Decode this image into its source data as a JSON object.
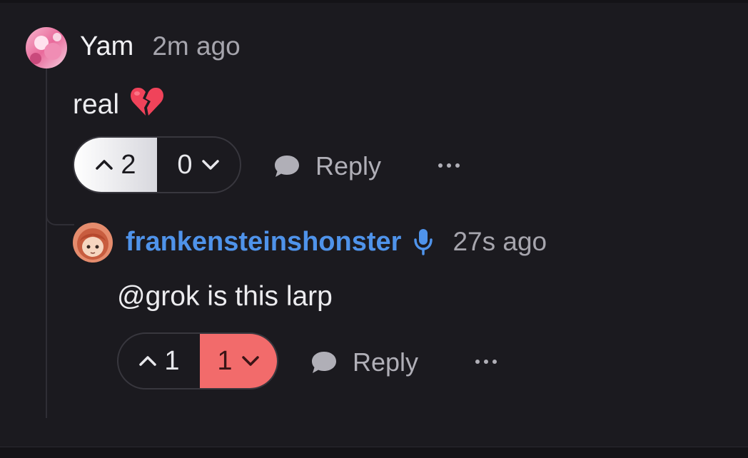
{
  "comments": [
    {
      "username": "Yam",
      "time": "2m ago",
      "text": "real",
      "emoji": "broken-heart",
      "upvotes": "2",
      "downvotes": "0",
      "upvote_state": "active",
      "reply_label": "Reply"
    },
    {
      "username": "frankensteinshonster",
      "time": "27s ago",
      "text": "@grok is this larp",
      "badge": "mic-icon",
      "upvotes": "1",
      "downvotes": "1",
      "downvote_state": "active",
      "reply_label": "Reply"
    }
  ],
  "colors": {
    "background": "#1b1a1f",
    "link": "#4f93ea",
    "downvote_active": "#f26b6b",
    "upvote_active": "#e9e9ee"
  }
}
